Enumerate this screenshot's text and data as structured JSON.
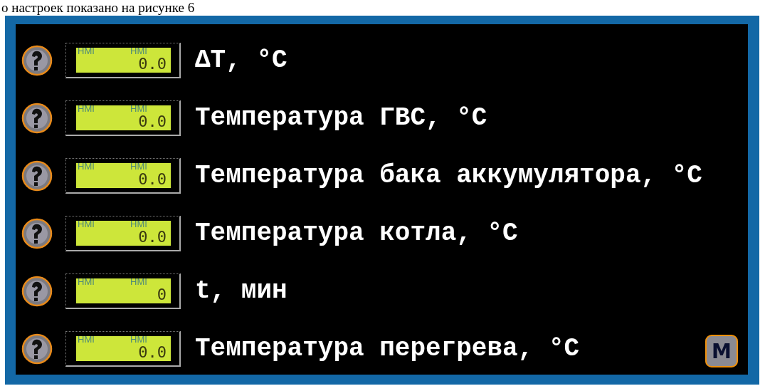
{
  "caption": "о настроек показано на рисунке 6",
  "rows": [
    {
      "hints": [
        "HMI",
        "HMI"
      ],
      "value": "0.0",
      "label": "ΔT, °C"
    },
    {
      "hints": [
        "HMI",
        "HMI"
      ],
      "value": "0.0",
      "label": "Температура ГВС, °C"
    },
    {
      "hints": [
        "HMI",
        "HMI"
      ],
      "value": "0.0",
      "label": "Температура бака аккумулятора, °C"
    },
    {
      "hints": [
        "HMI",
        "HMI"
      ],
      "value": "0.0",
      "label": "Температура котла, °C"
    },
    {
      "hints": [
        "HMI",
        "HMI"
      ],
      "value": "0",
      "label": "t, мин"
    },
    {
      "hints": [
        "HMI",
        "HMI"
      ],
      "value": "0.0",
      "label": "Температура перегрева, °C"
    }
  ],
  "menu_button": "M"
}
